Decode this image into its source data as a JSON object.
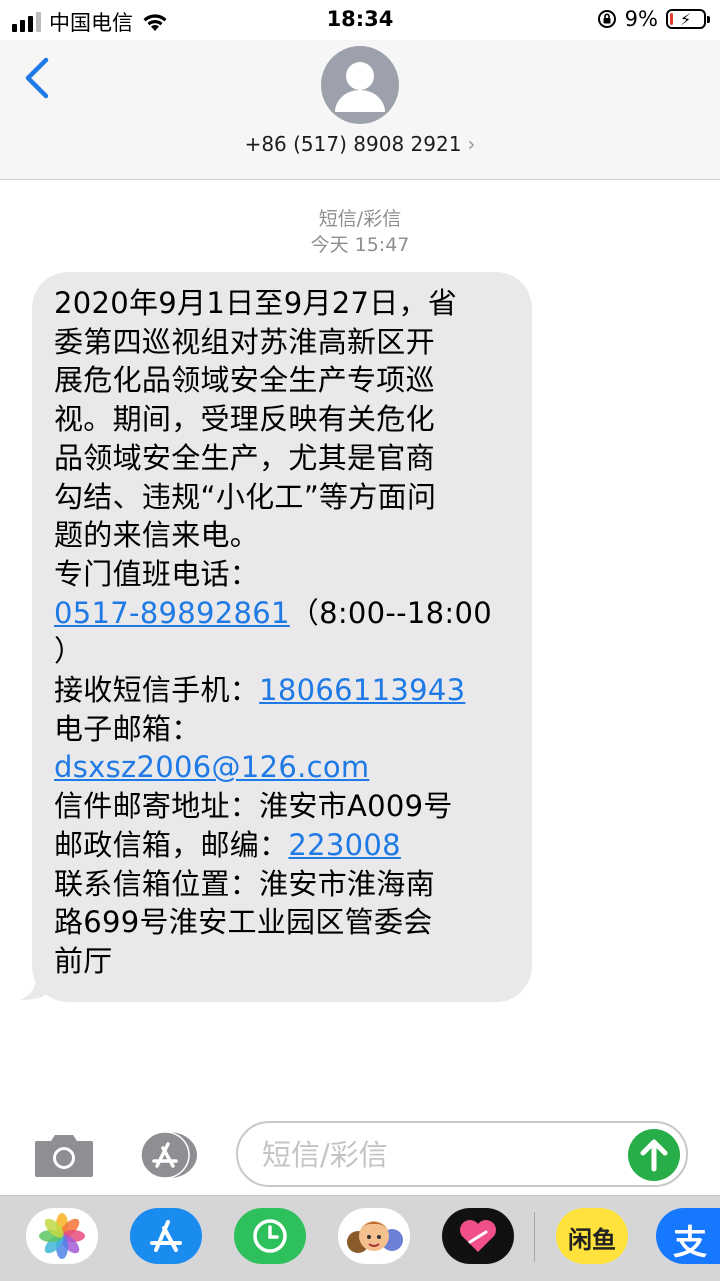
{
  "status_bar": {
    "carrier": "中国电信",
    "time": "18:34",
    "battery_percent": "9%",
    "battery_level": 0.09,
    "icons": [
      "signal-icon",
      "wifi-icon",
      "orientation-lock-icon",
      "battery-icon"
    ]
  },
  "header": {
    "contact_number": "+86 (517) 8908 2921",
    "chevron": "›",
    "icons": [
      "back-icon",
      "avatar-icon"
    ]
  },
  "thread": {
    "message_type": "短信/彩信",
    "timestamp": "今天 15:47"
  },
  "message": {
    "segments": [
      {
        "text": "2020年9月1日至9月27日，省"
      },
      {
        "text": "委第四巡视组对苏淮高新区开"
      },
      {
        "text": "展危化品领域安全生产专项巡"
      },
      {
        "text": "视。期间，受理反映有关危化"
      },
      {
        "text": "品领域安全生产，尤其是官商"
      },
      {
        "text": "勾结、违规“小化工”等方面问"
      },
      {
        "text": "题的来信来电。"
      },
      {
        "text": "专门值班电话："
      },
      {
        "link": "0517-89892861",
        "after": "（8:00--18:00"
      },
      {
        "text": "）"
      },
      {
        "text": "接收短信手机：",
        "link": "18066113943"
      },
      {
        "text": "电子邮箱："
      },
      {
        "link": "dsxsz2006@126.com"
      },
      {
        "text": "信件邮寄地址：淮安市A009号"
      },
      {
        "text": "邮政信箱，邮编：",
        "link": "223008"
      },
      {
        "text": "联系信箱位置：淮安市淮海南"
      },
      {
        "text": "路699号淮安工业园区管委会"
      },
      {
        "text": "前厅"
      }
    ]
  },
  "input_bar": {
    "placeholder": "短信/彩信",
    "icons": [
      "camera-icon",
      "app-store-icon",
      "send-arrow-icon"
    ]
  },
  "app_drawer": {
    "apps": [
      "photos",
      "app-store",
      "screen-time",
      "memoji",
      "heart-app",
      "xianyu-app",
      "alipay-app"
    ],
    "xianyu_label": "闲鱼",
    "alipay_label": "支"
  },
  "colors": {
    "link": "#1f7ae6",
    "bubble": "#e9e9eb",
    "send": "#27ae49",
    "back": "#1f7ae6"
  }
}
